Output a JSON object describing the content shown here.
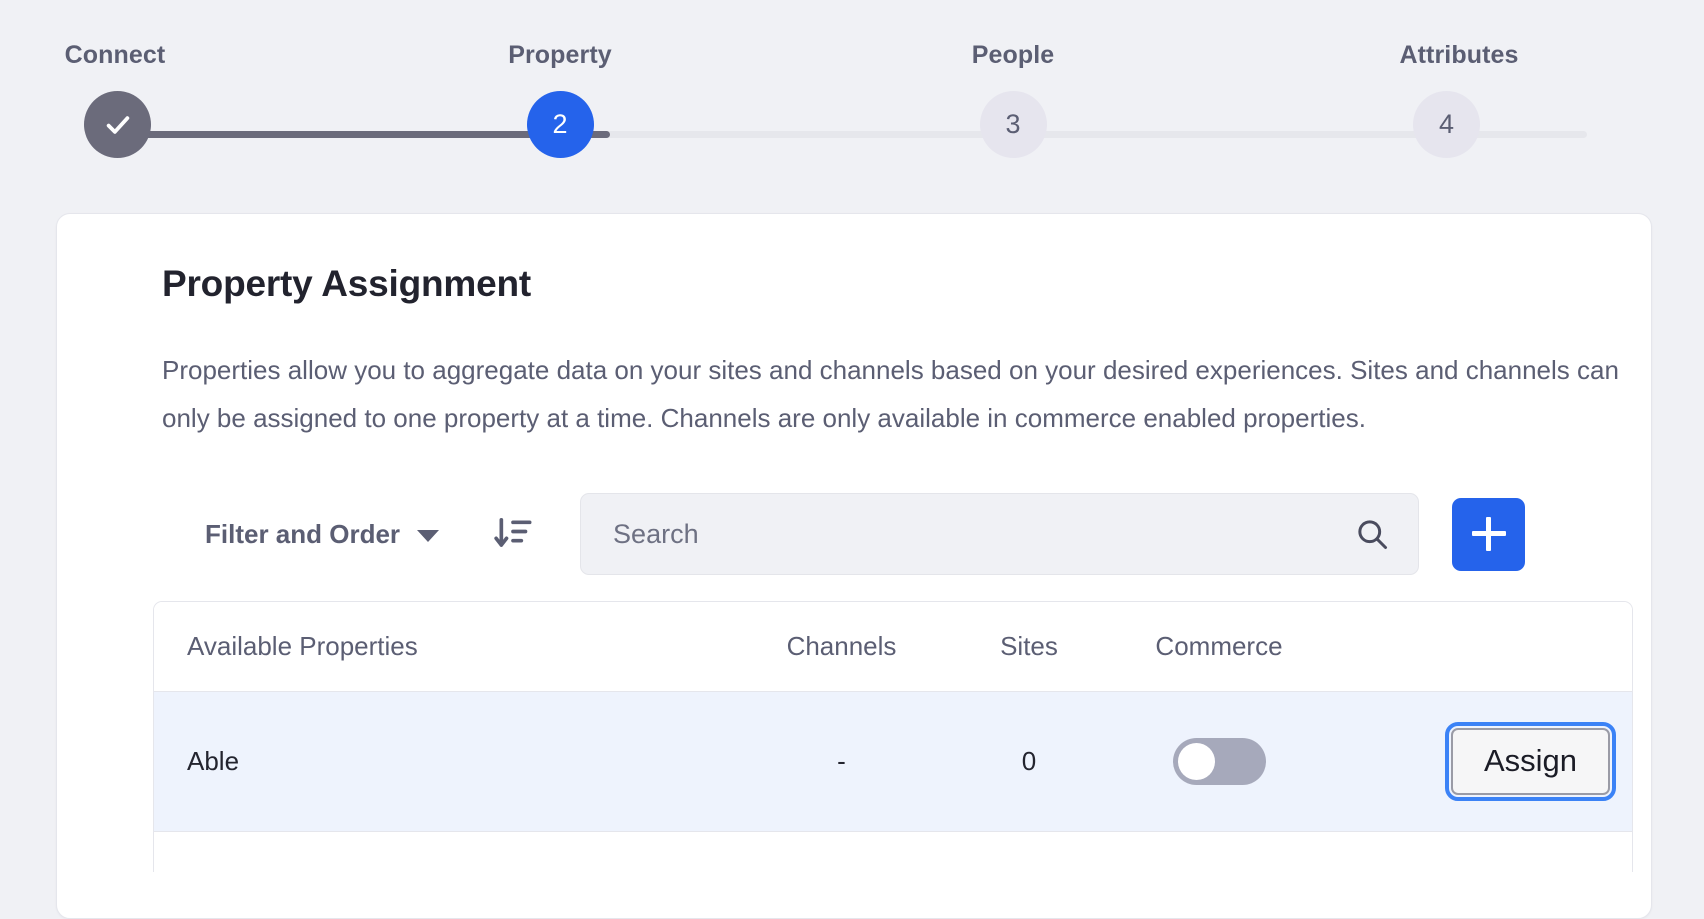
{
  "stepper": {
    "steps": [
      {
        "label": "Connect",
        "marker": "✓",
        "state": "done"
      },
      {
        "label": "Property",
        "marker": "2",
        "state": "active"
      },
      {
        "label": "People",
        "marker": "3",
        "state": "pending"
      },
      {
        "label": "Attributes",
        "marker": "4",
        "state": "pending"
      }
    ],
    "active_index": 2,
    "colors": {
      "done": "#6b6b7b",
      "active": "#2563eb",
      "pending": "#e6e5ee",
      "track": "#e6e7ec"
    }
  },
  "card": {
    "title": "Property Assignment",
    "description": "Properties allow you to aggregate data on your sites and channels based on your desired experiences. Sites and channels can only be assigned to one property at a time. Channels are only available in commerce enabled properties."
  },
  "toolbar": {
    "filter_label": "Filter and Order",
    "filter_caret_icon": "chevron-down-icon",
    "sort_icon": "sort-descending-icon",
    "search": {
      "value": "",
      "placeholder": "Search",
      "icon": "search-icon"
    },
    "add_button": {
      "icon": "plus-icon",
      "label": "",
      "color": "#2563eb"
    }
  },
  "table": {
    "columns": [
      "Available Properties",
      "Channels",
      "Sites",
      "Commerce",
      ""
    ],
    "rows": [
      {
        "name": "Able",
        "channels": "-",
        "sites": "0",
        "commerce_enabled": false,
        "action_label": "Assign",
        "selected": true,
        "focused_action": true
      }
    ]
  }
}
